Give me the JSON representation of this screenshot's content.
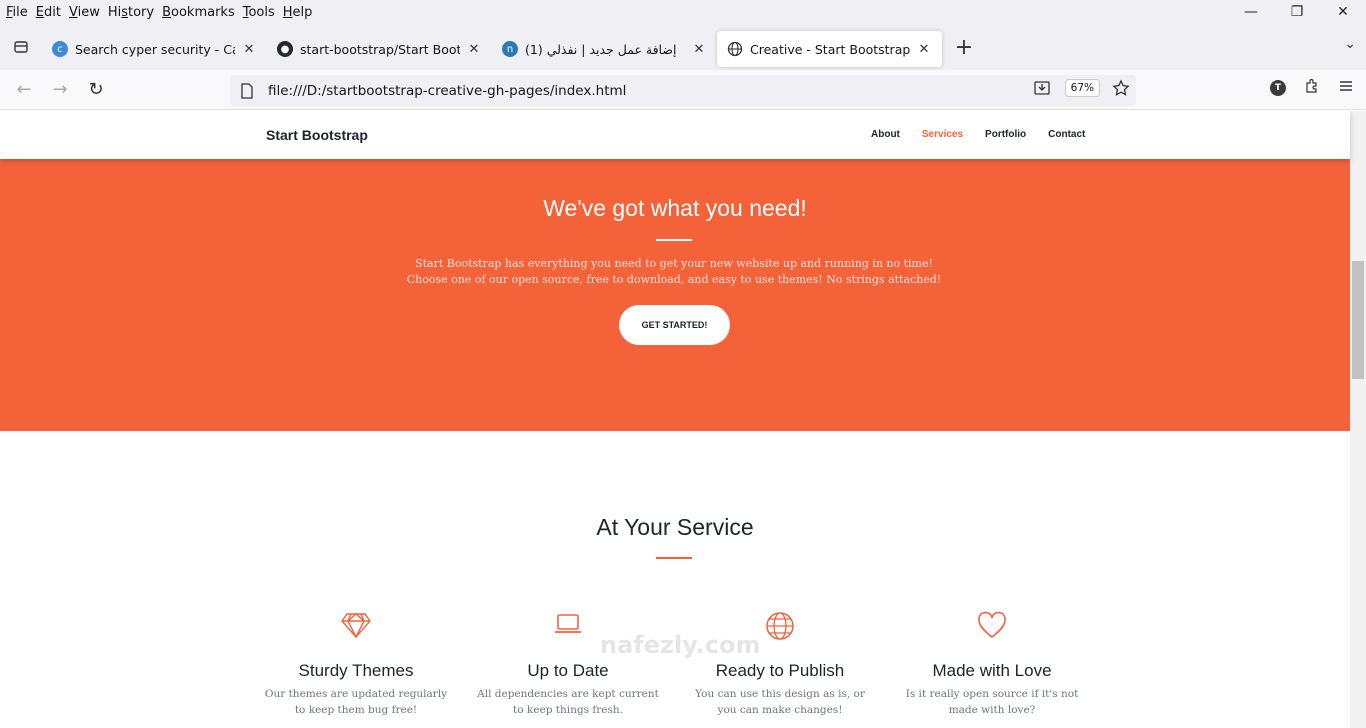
{
  "menu": [
    "File",
    "Edit",
    "View",
    "History",
    "Bookmarks",
    "Tools",
    "Help"
  ],
  "menu_underline": [
    "F",
    "E",
    "V",
    "s",
    "B",
    "T",
    "H"
  ],
  "tabs": [
    {
      "title": "Search cyper security - Canva",
      "favicon": "canva-icon",
      "active": false
    },
    {
      "title": "start-bootstrap/Start Bootstrap",
      "favicon": "github-icon",
      "active": false
    },
    {
      "title": "إضافة عمل جديد | نفذلي (1)",
      "favicon": "nafezly-icon",
      "active": false
    },
    {
      "title": "Creative - Start Bootstrap Them",
      "favicon": "globe-icon",
      "active": true
    }
  ],
  "url": "file:///D:/startbootstrap-creative-gh-pages/index.html",
  "zoom": "67%",
  "account_initial": "T",
  "site": {
    "brand": "Start Bootstrap",
    "nav": [
      "About",
      "Services",
      "Portfolio",
      "Contact"
    ],
    "active_nav": "Services"
  },
  "hero": {
    "title": "We've got what you need!",
    "text": "Start Bootstrap has everything you need to get your new website up and running in no time! Choose one of our open source, free to download, and easy to use themes! No strings attached!",
    "button": "GET STARTED!"
  },
  "services": {
    "title": "At Your Service",
    "items": [
      {
        "icon": "gem-icon",
        "title": "Sturdy Themes",
        "text": "Our themes are updated regularly to keep them bug free!"
      },
      {
        "icon": "laptop-icon",
        "title": "Up to Date",
        "text": "All dependencies are kept current to keep things fresh."
      },
      {
        "icon": "globe-icon",
        "title": "Ready to Publish",
        "text": "You can use this design as is, or you can make changes!"
      },
      {
        "icon": "heart-icon",
        "title": "Made with Love",
        "text": "Is it really open source if it's not made with love?"
      }
    ]
  },
  "watermark": "nafezly.com",
  "colors": {
    "accent": "#f4623a",
    "text": "#212529",
    "muted": "#6c757d"
  }
}
